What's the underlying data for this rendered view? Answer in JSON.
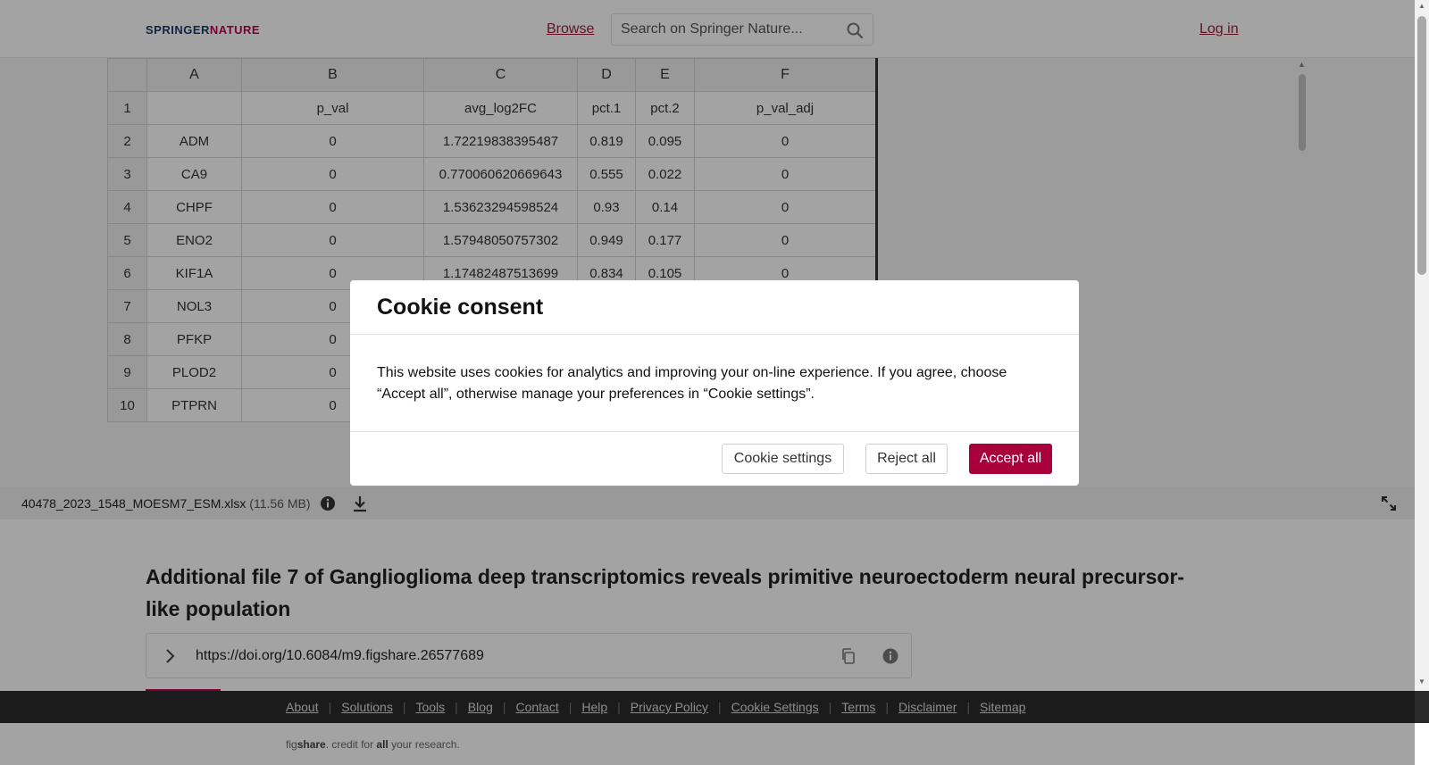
{
  "header": {
    "logo_part1": "SPRINGER",
    "logo_part2": "NATURE",
    "browse": "Browse",
    "search_placeholder": "Search on Springer Nature...",
    "login": "Log in"
  },
  "sheet": {
    "columns": [
      "A",
      "B",
      "C",
      "D",
      "E",
      "F"
    ],
    "rows": [
      {
        "n": "1",
        "cells": [
          "",
          "p_val",
          "avg_log2FC",
          "pct.1",
          "pct.2",
          "p_val_adj"
        ]
      },
      {
        "n": "2",
        "cells": [
          "ADM",
          "0",
          "1.72219838395487",
          "0.819",
          "0.095",
          "0"
        ]
      },
      {
        "n": "3",
        "cells": [
          "CA9",
          "0",
          "0.770060620669643",
          "0.555",
          "0.022",
          "0"
        ]
      },
      {
        "n": "4",
        "cells": [
          "CHPF",
          "0",
          "1.53623294598524",
          "0.93",
          "0.14",
          "0"
        ]
      },
      {
        "n": "5",
        "cells": [
          "ENO2",
          "0",
          "1.57948050757302",
          "0.949",
          "0.177",
          "0"
        ]
      },
      {
        "n": "6",
        "cells": [
          "KIF1A",
          "0",
          "1.17482487513699",
          "0.834",
          "0.105",
          "0"
        ]
      },
      {
        "n": "7",
        "cells": [
          "NOL3",
          "0",
          "",
          "",
          "",
          ""
        ]
      },
      {
        "n": "8",
        "cells": [
          "PFKP",
          "0",
          "",
          "",
          "",
          ""
        ]
      },
      {
        "n": "9",
        "cells": [
          "PLOD2",
          "0",
          "",
          "",
          "",
          ""
        ]
      },
      {
        "n": "10",
        "cells": [
          "PTPRN",
          "0",
          "",
          "",
          "",
          ""
        ]
      }
    ]
  },
  "file": {
    "name": "40478_2023_1548_MOESM7_ESM.xlsx",
    "size": "(11.56 MB)"
  },
  "content": {
    "title": "Additional file 7 of Ganglioglioma deep transcriptomics reveals primitive neuroectoderm neural precursor-like population",
    "doi": "https://doi.org/10.6084/m9.figshare.26577689"
  },
  "footer": {
    "links": [
      "About",
      "Solutions",
      "Tools",
      "Blog",
      "Contact",
      "Help",
      "Privacy Policy",
      "Cookie Settings",
      "Terms",
      "Disclaimer",
      "Sitemap"
    ],
    "credit_fig": "fig",
    "credit_share": "share",
    "credit_mid": ". credit for ",
    "credit_all": "all",
    "credit_end": " your research."
  },
  "modal": {
    "title": "Cookie consent",
    "body": "This website uses cookies for analytics and improving your on-line experience. If you agree, choose “Accept all”, otherwise manage your preferences in “Cookie settings”.",
    "settings_label": "Cookie settings",
    "reject_label": "Reject all",
    "accept_label": "Accept all"
  },
  "colors": {
    "accent": "#a8003b",
    "link": "#9b1f3a",
    "footer_bg": "#2b2b2b"
  }
}
